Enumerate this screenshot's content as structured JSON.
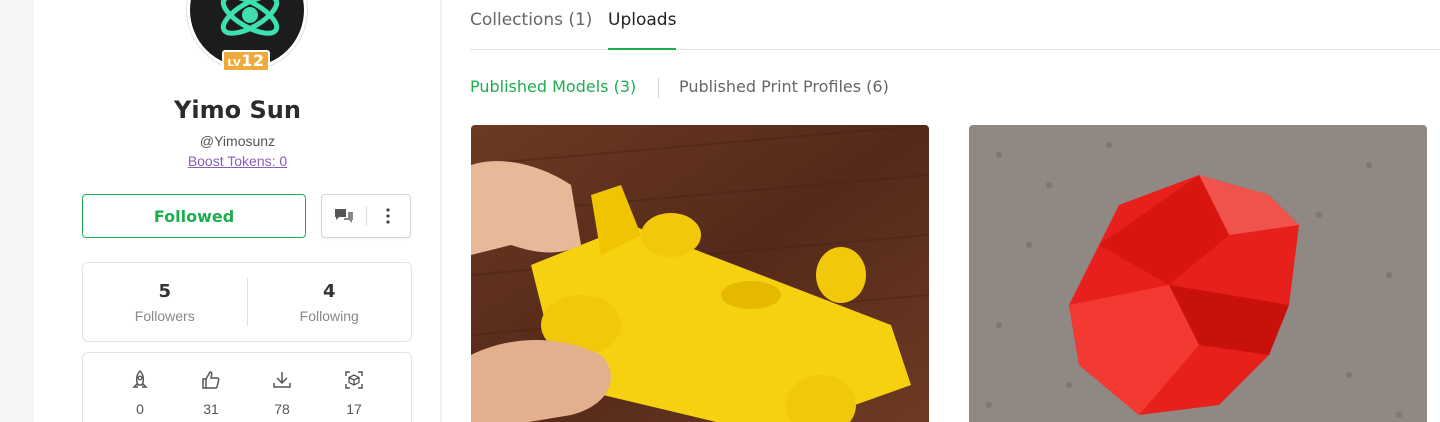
{
  "profile": {
    "name": "Yimo Sun",
    "handle": "@Yimosunz",
    "boost_tokens": "Boost Tokens: 0",
    "level_prefix": "LV",
    "level_number": "12"
  },
  "actions": {
    "follow_label": "Followed",
    "message_icon": "chat-bubbles-icon",
    "more_icon": "more-vertical-icon"
  },
  "follow_stats": {
    "followers_count": "5",
    "followers_label": "Followers",
    "following_count": "4",
    "following_label": "Following"
  },
  "activity_stats": [
    {
      "icon": "boost-rocket-icon",
      "value": "0"
    },
    {
      "icon": "thumbs-up-icon",
      "value": "31"
    },
    {
      "icon": "download-icon",
      "value": "78"
    },
    {
      "icon": "3d-print-icon",
      "value": "17"
    }
  ],
  "tabs": [
    {
      "label": "Collections (1)",
      "active": false
    },
    {
      "label": "Uploads",
      "active": true
    }
  ],
  "subtabs": [
    {
      "label": "Published Models (3)",
      "active": true
    },
    {
      "label": "Published Print Profiles (6)",
      "active": false
    }
  ],
  "colors": {
    "accent": "#1cae4e",
    "boost_link": "#8a5fb8",
    "level_badge": "#f0a93c",
    "card1_model": "#f5d10f",
    "card2_model": "#e8201c"
  }
}
